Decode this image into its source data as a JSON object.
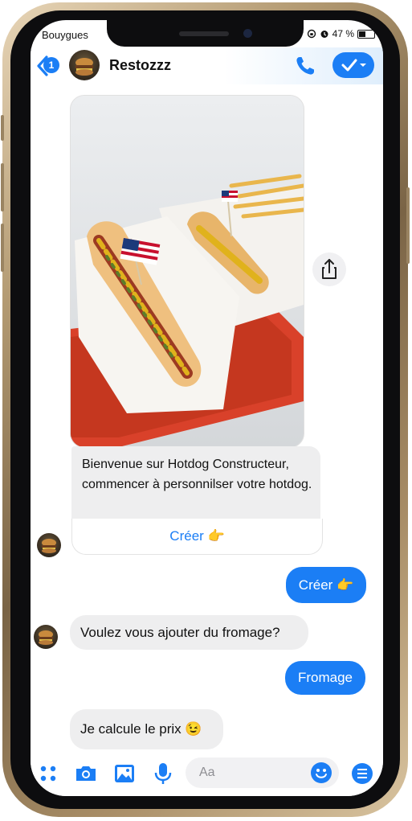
{
  "status_bar": {
    "carrier": "Bouygues",
    "battery": "47 %"
  },
  "header": {
    "back_count": "1",
    "title": "Restozzz"
  },
  "messages": {
    "welcome_text": "Bienvenue sur Hotdog Constructeur, commencer à personnilser votre hotdog.",
    "welcome_button": "Créer 👉",
    "out1": "Créer 👉",
    "in1": "Voulez vous ajouter du fromage?",
    "out2": "Fromage",
    "in2": "Je calcule le prix 😉"
  },
  "composer": {
    "placeholder": "Aa"
  },
  "colors": {
    "accent": "#1b7ef5",
    "incoming_bubble": "#eeeeef",
    "tray": "#d9412a"
  },
  "icons": [
    "back-chevron-icon",
    "phone-icon",
    "checkmark-icon",
    "share-icon",
    "apps-icon",
    "camera-icon",
    "gallery-icon",
    "microphone-icon",
    "emoji-icon",
    "menu-icon"
  ]
}
